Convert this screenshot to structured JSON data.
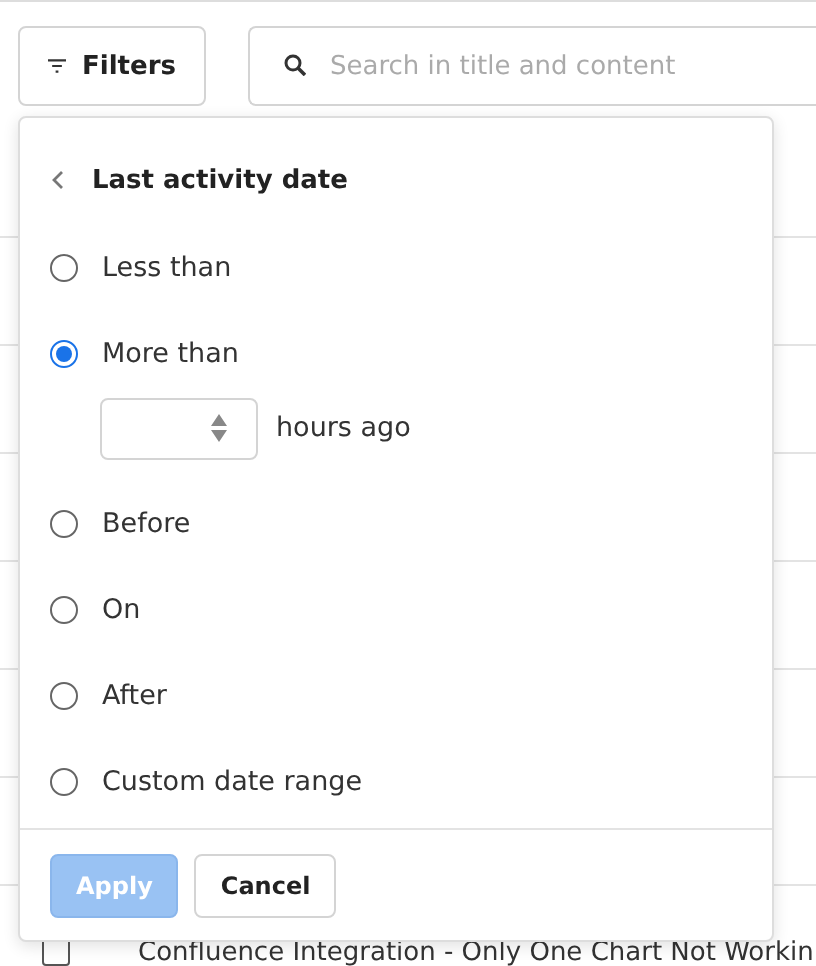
{
  "toolbar": {
    "filters_button": "Filters",
    "search": {
      "placeholder": "Search in title and content"
    }
  },
  "filter_popup": {
    "title": "Last activity date",
    "options": [
      {
        "label": "Less than",
        "selected": false
      },
      {
        "label": "More than",
        "selected": true
      },
      {
        "label": "Before",
        "selected": false
      },
      {
        "label": "On",
        "selected": false
      },
      {
        "label": "After",
        "selected": false
      },
      {
        "label": "Custom date range",
        "selected": false
      }
    ],
    "amount_field": {
      "unit": "hours ago"
    },
    "buttons": [
      {
        "label": "Apply",
        "kind": "primary",
        "disabled": true
      },
      {
        "label": "Cancel",
        "kind": "secondary",
        "disabled": false
      }
    ]
  },
  "list": {
    "rows": [
      {
        "title": "Confluence Integration - Only One Chart Not Workin",
        "checked": false
      }
    ]
  }
}
